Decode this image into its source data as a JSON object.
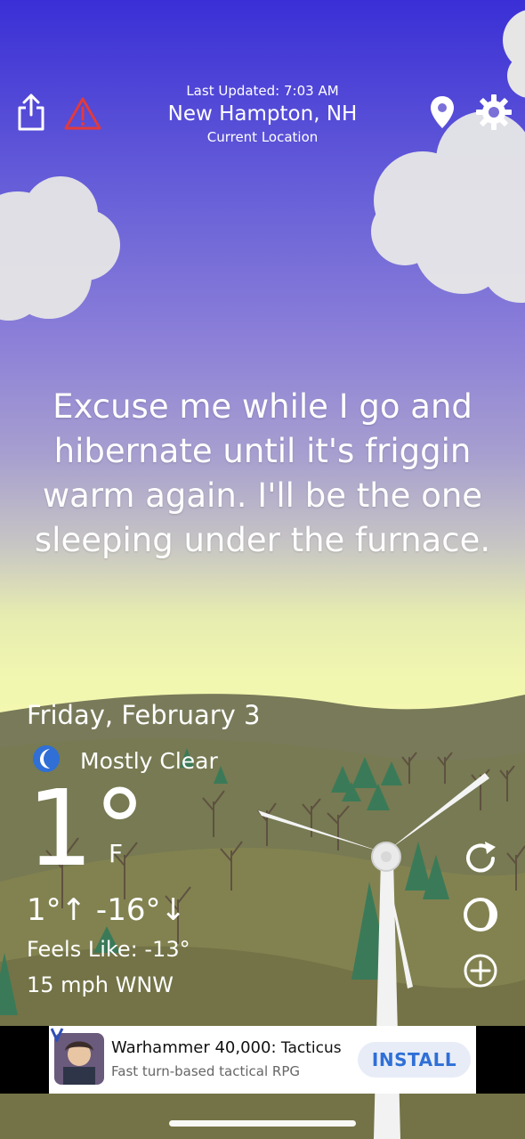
{
  "header": {
    "last_updated": "Last Updated: 7:03 AM",
    "location": "New Hampton, NH",
    "location_sub": "Current Location"
  },
  "icons": {
    "share": "share-icon",
    "alert": "alert-triangle-icon",
    "location_pin": "map-pin-icon",
    "settings": "gear-icon",
    "moon": "moon-icon",
    "refresh": "refresh-icon",
    "theme": "moon-phase-icon",
    "add": "plus-circle-icon",
    "ad_logo": "v-logo-icon"
  },
  "quote": "Excuse me while I go and hibernate until it's friggin warm again. I'll be the one sleeping under the furnace.",
  "weather": {
    "date": "Friday, February 3",
    "condition": "Mostly Clear",
    "temp": "1°",
    "unit": "F",
    "high_low": "1°↑  -16°↓",
    "feels_like": "Feels Like: -13°",
    "wind": "15 mph WNW"
  },
  "ad": {
    "title_bold": "Warhammer 40,000:",
    "title_rest": " Tacticus",
    "subtitle": "Fast turn-based tactical RPG",
    "install": "INSTALL"
  },
  "colors": {
    "sky_top": "#3a2fd6",
    "sky_bottom": "#f4f7b0",
    "ground": "#6b6e48",
    "tree_green": "#2f7a3e",
    "install_text": "#2f6fd6",
    "alert_red": "#e33a3a",
    "moon_blue": "#2f6fd6"
  }
}
